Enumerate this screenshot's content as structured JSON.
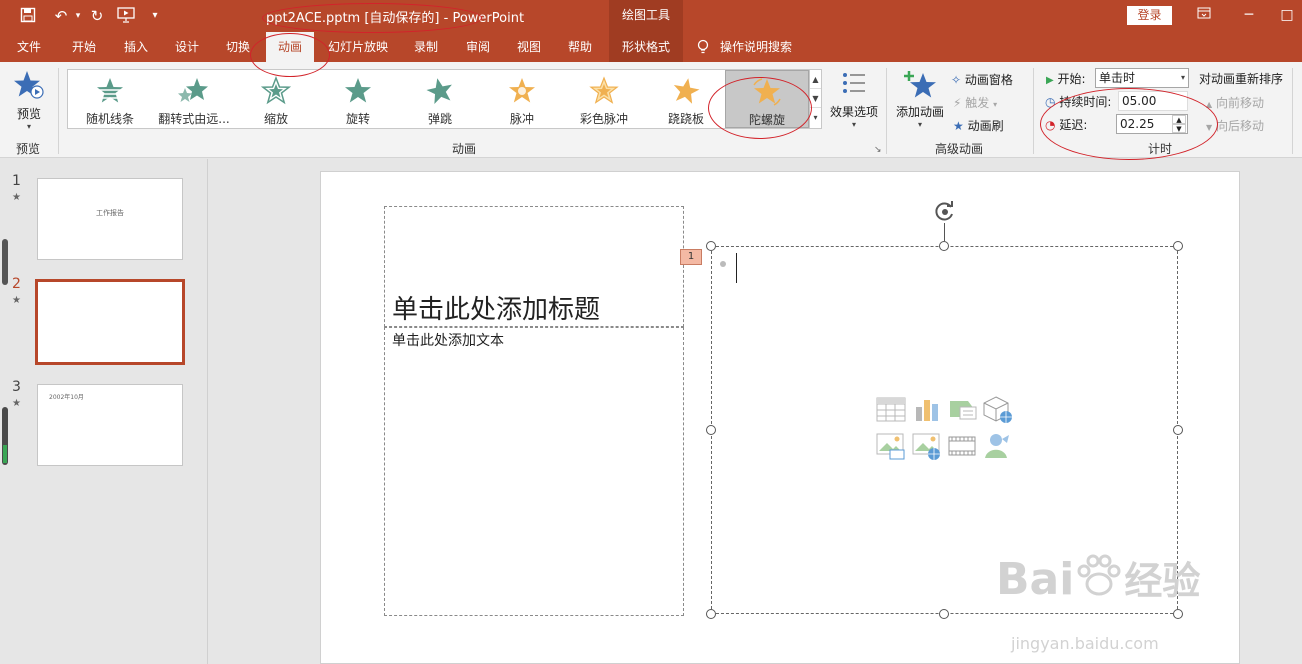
{
  "window": {
    "title": "ppt2ACE.pptm [自动保存的]  -  PowerPoint",
    "context_tab": "绘图工具",
    "login_label": "登录"
  },
  "quick_access": {
    "icons": [
      "save-icon",
      "undo-icon",
      "redo-icon",
      "present-from-beginning-icon",
      "customize-icon"
    ]
  },
  "tabs": [
    {
      "label": "文件"
    },
    {
      "label": "开始"
    },
    {
      "label": "插入"
    },
    {
      "label": "设计"
    },
    {
      "label": "切换"
    },
    {
      "label": "动画",
      "active": true
    },
    {
      "label": "幻灯片放映"
    },
    {
      "label": "录制"
    },
    {
      "label": "审阅"
    },
    {
      "label": "视图"
    },
    {
      "label": "帮助"
    },
    {
      "label": "形状格式"
    }
  ],
  "tell_me": "操作说明搜索",
  "ribbon": {
    "preview": {
      "button_label": "预览",
      "group_label": "预览"
    },
    "animation_group": {
      "group_label": "动画",
      "effects": [
        {
          "label": "随机线条",
          "color": "#5b9b8a"
        },
        {
          "label": "翻转式由远...",
          "color": "#5b9b8a"
        },
        {
          "label": "缩放",
          "color": "#5b9b8a"
        },
        {
          "label": "旋转",
          "color": "#5b9b8a"
        },
        {
          "label": "弹跳",
          "color": "#5b9b8a"
        },
        {
          "label": "脉冲",
          "color": "#f0b050"
        },
        {
          "label": "彩色脉冲",
          "color": "#f0b050"
        },
        {
          "label": "跷跷板",
          "color": "#f0b050"
        },
        {
          "label": "陀螺旋",
          "color": "#f0b050",
          "selected": true
        }
      ],
      "effect_options_label": "效果选项"
    },
    "advanced_group": {
      "group_label": "高级动画",
      "add_animation_label": "添加动画",
      "animation_pane_label": "动画窗格",
      "trigger_label": "触发",
      "painter_label": "动画刷"
    },
    "timing_group": {
      "group_label": "计时",
      "start_label": "开始:",
      "start_value": "单击时",
      "duration_label": "持续时间:",
      "duration_value": "05.00",
      "delay_label": "延迟:",
      "delay_value": "02.25",
      "reorder_label": "对动画重新排序",
      "move_earlier_label": "向前移动",
      "move_later_label": "向后移动"
    }
  },
  "slides": [
    {
      "number": "1",
      "star": "★",
      "text": "工作报告"
    },
    {
      "number": "2",
      "star": "★",
      "text": "",
      "selected": true
    },
    {
      "number": "3",
      "star": "★",
      "text": "2002年10月"
    }
  ],
  "slide": {
    "title_placeholder": "单击此处添加标题",
    "text_placeholder": "单击此处添加文本",
    "animation_tag": "1"
  },
  "watermark": {
    "main": "Bai",
    "sub": "经验",
    "url": "jingyan.baidu.com"
  },
  "colors": {
    "accent": "#b7472a",
    "annotation": "#d2232a"
  }
}
